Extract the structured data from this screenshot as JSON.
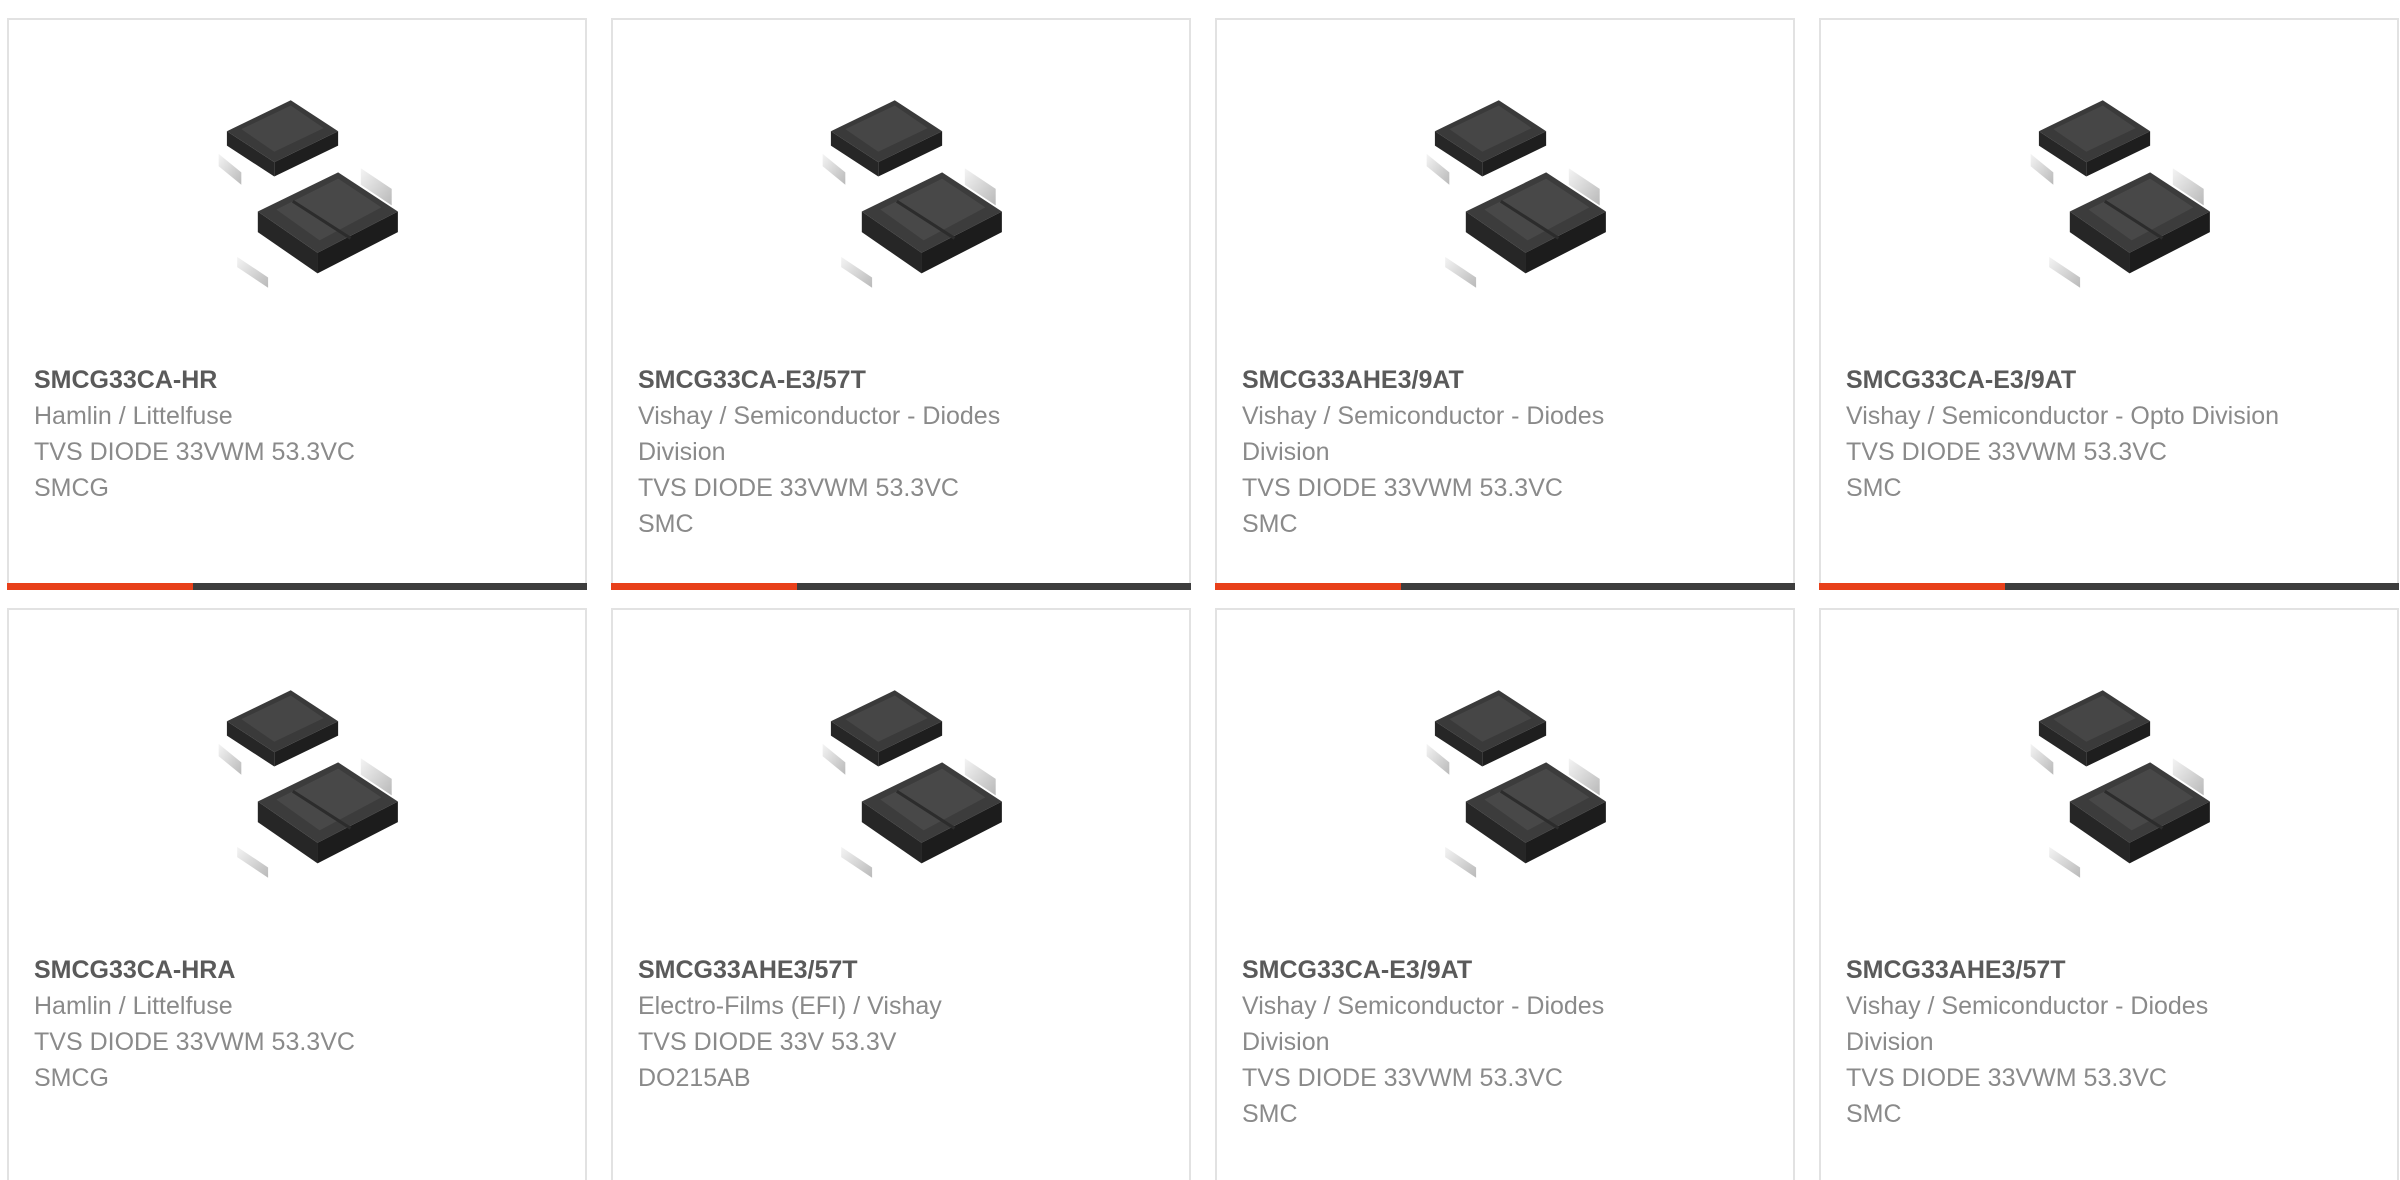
{
  "colors": {
    "accent": "#e8401a",
    "bar_track": "#3d3d3d",
    "border": "#e2e2e2",
    "title_text": "#5a5a5a",
    "body_text": "#8a8a8a"
  },
  "products": [
    {
      "part_number": "SMCG33CA-HR",
      "manufacturer": "Hamlin / Littelfuse",
      "description": "TVS DIODE 33VWM 53.3VC",
      "package": "SMCG",
      "image_icon": "smc-diode-package-image",
      "bar_fill": 0.32
    },
    {
      "part_number": "SMCG33CA-E3/57T",
      "manufacturer": "Vishay / Semiconductor - Diodes Division",
      "description": "TVS DIODE 33VWM 53.3VC",
      "package": "SMC",
      "image_icon": "smc-diode-package-image",
      "bar_fill": 0.32
    },
    {
      "part_number": "SMCG33AHE3/9AT",
      "manufacturer": "Vishay / Semiconductor - Diodes Division",
      "description": "TVS DIODE 33VWM 53.3VC",
      "package": "SMC",
      "image_icon": "smc-diode-package-image",
      "bar_fill": 0.32
    },
    {
      "part_number": "SMCG33CA-E3/9AT",
      "manufacturer": "Vishay / Semiconductor - Opto Division",
      "description": "TVS DIODE 33VWM 53.3VC",
      "package": "SMC",
      "image_icon": "smc-diode-package-image",
      "bar_fill": 0.32
    },
    {
      "part_number": "SMCG33CA-HRA",
      "manufacturer": "Hamlin / Littelfuse",
      "description": "TVS DIODE 33VWM 53.3VC",
      "package": "SMCG",
      "image_icon": "smc-diode-package-image",
      "bar_fill": 0
    },
    {
      "part_number": "SMCG33AHE3/57T",
      "manufacturer": "Electro-Films (EFI) / Vishay",
      "description": "TVS DIODE 33V 53.3V",
      "package": "DO215AB",
      "image_icon": "smc-diode-package-image",
      "bar_fill": 0
    },
    {
      "part_number": "SMCG33CA-E3/9AT",
      "manufacturer": "Vishay / Semiconductor - Diodes Division",
      "description": "TVS DIODE 33VWM 53.3VC",
      "package": "SMC",
      "image_icon": "smc-diode-package-image",
      "bar_fill": 0
    },
    {
      "part_number": "SMCG33AHE3/57T",
      "manufacturer": "Vishay / Semiconductor - Diodes Division",
      "description": "TVS DIODE 33VWM 53.3VC",
      "package": "SMC",
      "image_icon": "smc-diode-package-image",
      "bar_fill": 0
    }
  ]
}
